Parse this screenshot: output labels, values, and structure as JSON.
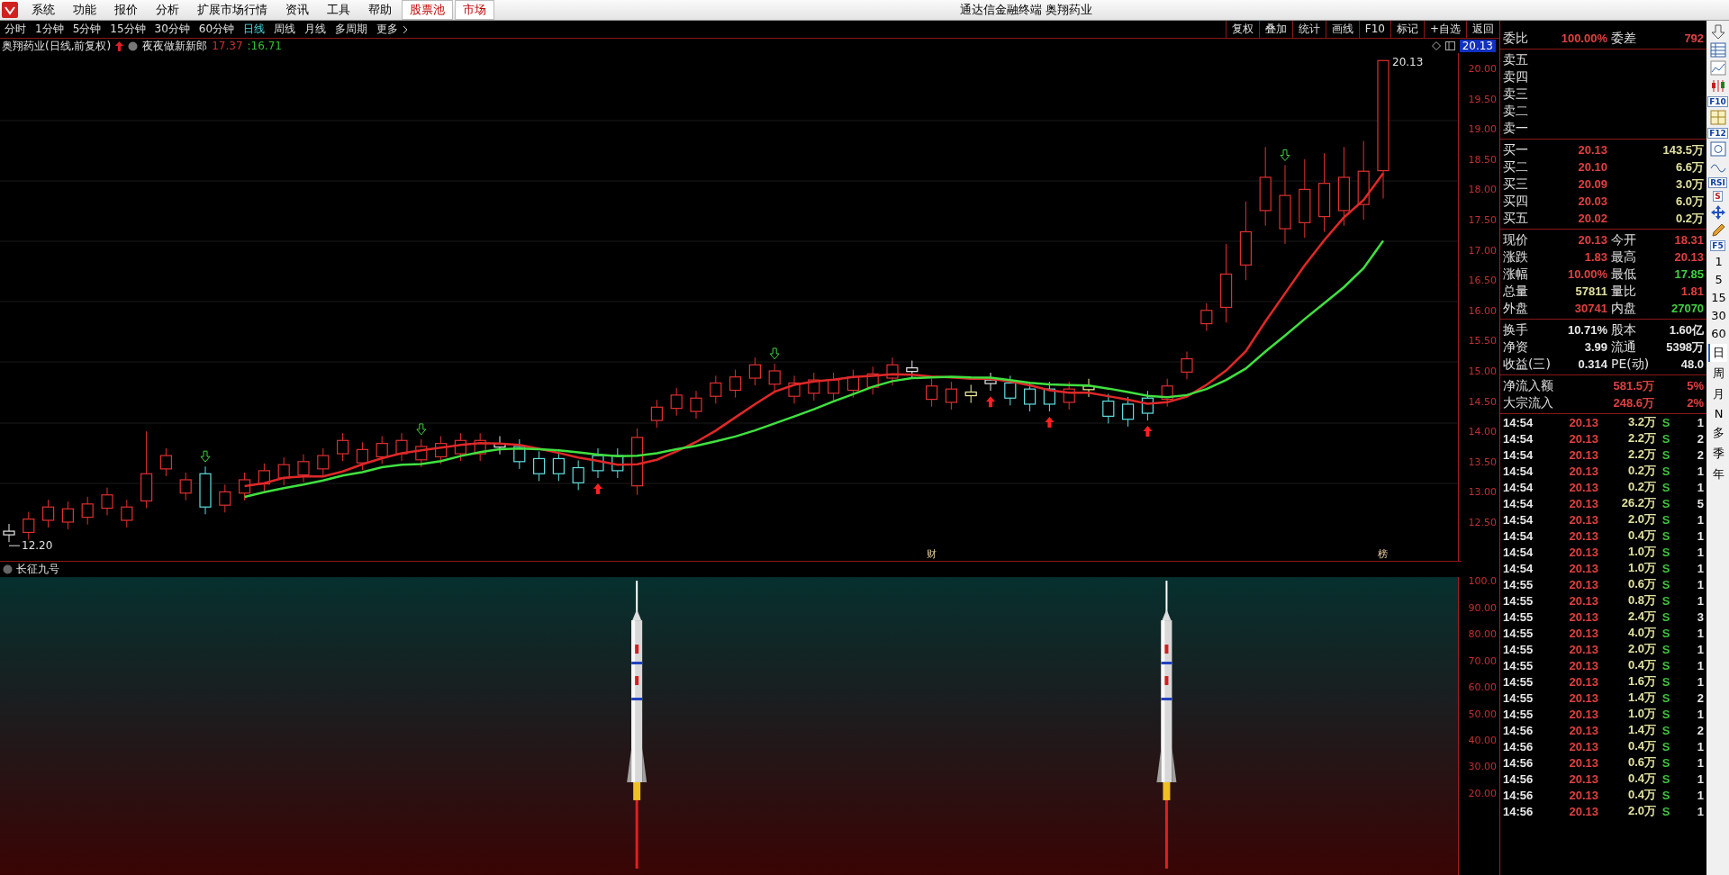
{
  "menu_bar": {
    "items": [
      {
        "label": "系统",
        "kind": "menu"
      },
      {
        "label": "功能",
        "kind": "menu"
      },
      {
        "label": "报价",
        "kind": "menu"
      },
      {
        "label": "分析",
        "kind": "menu"
      },
      {
        "label": "扩展市场行情",
        "kind": "menu"
      },
      {
        "label": "资讯",
        "kind": "menu"
      },
      {
        "label": "工具",
        "kind": "menu"
      },
      {
        "label": "帮助",
        "kind": "menu"
      },
      {
        "label": "股票池",
        "kind": "boxed"
      },
      {
        "label": "市场",
        "kind": "boxed"
      }
    ],
    "title": "通达信金融终端  奥翔药业"
  },
  "period_bar": {
    "periods": [
      {
        "label": "分时",
        "selected": false
      },
      {
        "label": "1分钟",
        "selected": false
      },
      {
        "label": "5分钟",
        "selected": false
      },
      {
        "label": "15分钟",
        "selected": false
      },
      {
        "label": "30分钟",
        "selected": false
      },
      {
        "label": "60分钟",
        "selected": false
      },
      {
        "label": "日线",
        "selected": true
      },
      {
        "label": "周线",
        "selected": false
      },
      {
        "label": "月线",
        "selected": false
      },
      {
        "label": "多周期",
        "selected": false
      }
    ],
    "more": "更多",
    "actions": [
      "复权",
      "叠加",
      "统计",
      "画线",
      "F10",
      "标记",
      "+自选",
      "返回"
    ]
  },
  "chart": {
    "title": "奥翔药业(日线,前复权)",
    "indicator_name": "夜夜做新新郎",
    "ma_values": [
      {
        "text": "17.37",
        "color": "#d03030"
      },
      {
        "text": ":16.71",
        "color": "#30c030"
      }
    ],
    "last_price": "20.13",
    "high_label": "20.13",
    "low_label": "12.20",
    "markers": [
      "财",
      "榜"
    ],
    "price_axis": [
      "20.00",
      "19.50",
      "19.00",
      "18.50",
      "18.00",
      "17.50",
      "17.00",
      "16.50",
      "16.00",
      "15.50",
      "15.00",
      "14.50",
      "14.00",
      "13.50",
      "13.00",
      "12.50"
    ]
  },
  "indicator_panel": {
    "name": "长征九号",
    "axis": [
      "100.0",
      "90.00",
      "80.00",
      "70.00",
      "60.00",
      "50.00",
      "40.00",
      "30.00",
      "20.00"
    ]
  },
  "quote_panel": {
    "ratio": {
      "label": "委比",
      "value": "100.00%",
      "label2": "委差",
      "value2": "792"
    },
    "asks": [
      "卖五",
      "卖四",
      "卖三",
      "卖二",
      "卖一"
    ],
    "bids": [
      {
        "label": "买一",
        "price": "20.13",
        "volume": "143.5万"
      },
      {
        "label": "买二",
        "price": "20.10",
        "volume": "6.6万"
      },
      {
        "label": "买三",
        "price": "20.09",
        "volume": "3.0万"
      },
      {
        "label": "买四",
        "price": "20.03",
        "volume": "6.0万"
      },
      {
        "label": "买五",
        "price": "20.02",
        "volume": "0.2万"
      }
    ],
    "stats": [
      {
        "left": {
          "label": "现价",
          "value": "20.13",
          "color": "#e04040"
        },
        "right": {
          "label": "今开",
          "value": "18.31",
          "color": "#e04040"
        }
      },
      {
        "left": {
          "label": "涨跌",
          "value": "1.83",
          "color": "#e04040"
        },
        "right": {
          "label": "最高",
          "value": "20.13",
          "color": "#e04040"
        }
      },
      {
        "left": {
          "label": "涨幅",
          "value": "10.00%",
          "color": "#e04040"
        },
        "right": {
          "label": "最低",
          "value": "17.85",
          "color": "#40d040"
        }
      },
      {
        "left": {
          "label": "总量",
          "value": "57811",
          "color": "#e0e0a0"
        },
        "right": {
          "label": "量比",
          "value": "1.81",
          "color": "#e04040"
        }
      },
      {
        "left": {
          "label": "外盘",
          "value": "30741",
          "color": "#e04040"
        },
        "right": {
          "label": "内盘",
          "value": "27070",
          "color": "#40d040"
        }
      }
    ],
    "fundamentals": [
      {
        "label": "换手",
        "value": "10.71%",
        "label2": "股本",
        "value2": "1.60亿"
      },
      {
        "label": "净资",
        "value": "3.99",
        "label2": "流通",
        "value2": "5398万"
      },
      {
        "label": "收益(三)",
        "value": "0.314",
        "label2": "PE(动)",
        "value2": "48.0"
      }
    ],
    "flows": [
      {
        "label": "净流入额",
        "amount": "581.5万",
        "share": "5%"
      },
      {
        "label": "大宗流入",
        "amount": "248.6万",
        "share": "2%"
      }
    ],
    "trades": [
      {
        "time": "14:54",
        "price": "20.13",
        "volume": "3.2万",
        "side": "S",
        "count": "1"
      },
      {
        "time": "14:54",
        "price": "20.13",
        "volume": "2.2万",
        "side": "S",
        "count": "2"
      },
      {
        "time": "14:54",
        "price": "20.13",
        "volume": "2.2万",
        "side": "S",
        "count": "2"
      },
      {
        "time": "14:54",
        "price": "20.13",
        "volume": "0.2万",
        "side": "S",
        "count": "1"
      },
      {
        "time": "14:54",
        "price": "20.13",
        "volume": "0.2万",
        "side": "S",
        "count": "1"
      },
      {
        "time": "14:54",
        "price": "20.13",
        "volume": "26.2万",
        "side": "S",
        "count": "5"
      },
      {
        "time": "14:54",
        "price": "20.13",
        "volume": "2.0万",
        "side": "S",
        "count": "1"
      },
      {
        "time": "14:54",
        "price": "20.13",
        "volume": "0.4万",
        "side": "S",
        "count": "1"
      },
      {
        "time": "14:54",
        "price": "20.13",
        "volume": "1.0万",
        "side": "S",
        "count": "1"
      },
      {
        "time": "14:54",
        "price": "20.13",
        "volume": "1.0万",
        "side": "S",
        "count": "1"
      },
      {
        "time": "14:55",
        "price": "20.13",
        "volume": "0.6万",
        "side": "S",
        "count": "1"
      },
      {
        "time": "14:55",
        "price": "20.13",
        "volume": "0.8万",
        "side": "S",
        "count": "1"
      },
      {
        "time": "14:55",
        "price": "20.13",
        "volume": "2.4万",
        "side": "S",
        "count": "3"
      },
      {
        "time": "14:55",
        "price": "20.13",
        "volume": "4.0万",
        "side": "S",
        "count": "1"
      },
      {
        "time": "14:55",
        "price": "20.13",
        "volume": "2.0万",
        "side": "S",
        "count": "1"
      },
      {
        "time": "14:55",
        "price": "20.13",
        "volume": "0.4万",
        "side": "S",
        "count": "1"
      },
      {
        "time": "14:55",
        "price": "20.13",
        "volume": "1.6万",
        "side": "S",
        "count": "1"
      },
      {
        "time": "14:55",
        "price": "20.13",
        "volume": "1.4万",
        "side": "S",
        "count": "2"
      },
      {
        "time": "14:55",
        "price": "20.13",
        "volume": "1.0万",
        "side": "S",
        "count": "1"
      },
      {
        "time": "14:56",
        "price": "20.13",
        "volume": "1.4万",
        "side": "S",
        "count": "2"
      },
      {
        "time": "14:56",
        "price": "20.13",
        "volume": "0.4万",
        "side": "S",
        "count": "1"
      },
      {
        "time": "14:56",
        "price": "20.13",
        "volume": "0.6万",
        "side": "S",
        "count": "1"
      },
      {
        "time": "14:56",
        "price": "20.13",
        "volume": "0.4万",
        "side": "S",
        "count": "1"
      },
      {
        "time": "14:56",
        "price": "20.13",
        "volume": "0.4万",
        "side": "S",
        "count": "1"
      },
      {
        "time": "14:56",
        "price": "20.13",
        "volume": "2.0万",
        "side": "S",
        "count": "1"
      }
    ]
  },
  "side_bar": {
    "text_tools": [
      "F10",
      "F12",
      "RSI",
      "S",
      "F5"
    ],
    "periods": [
      {
        "label": "1",
        "selected": false
      },
      {
        "label": "5",
        "selected": false
      },
      {
        "label": "15",
        "selected": false
      },
      {
        "label": "30",
        "selected": false
      },
      {
        "label": "60",
        "selected": false
      },
      {
        "label": "日",
        "selected": true
      },
      {
        "label": "周",
        "selected": false
      },
      {
        "label": "月",
        "selected": false
      },
      {
        "label": "N",
        "selected": false
      },
      {
        "label": "多",
        "selected": false
      },
      {
        "label": "季",
        "selected": false
      },
      {
        "label": "年",
        "selected": false
      }
    ]
  }
}
